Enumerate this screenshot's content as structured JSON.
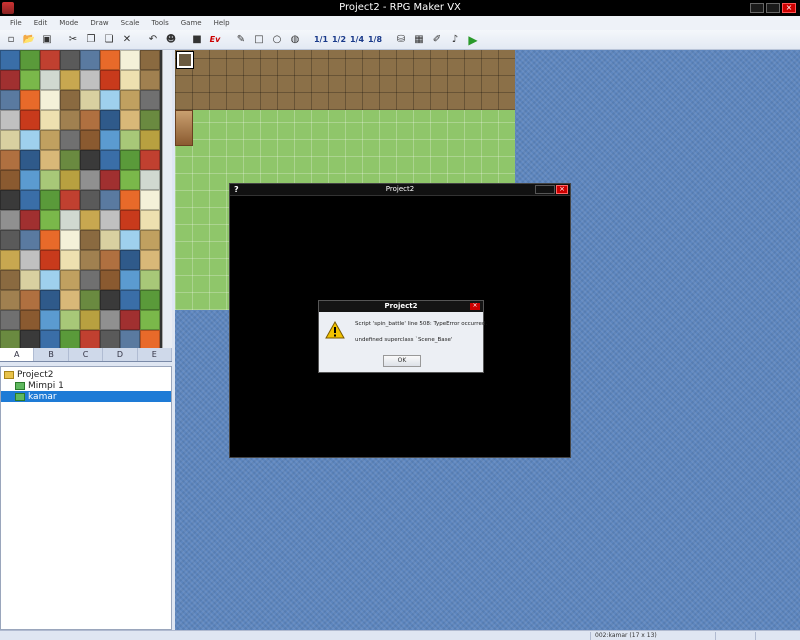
{
  "window": {
    "title": "Project2 - RPG Maker VX"
  },
  "menu": [
    "File",
    "Edit",
    "Mode",
    "Draw",
    "Scale",
    "Tools",
    "Game",
    "Help"
  ],
  "toolbar": {
    "icons": [
      "new-project-icon",
      "open-project-icon",
      "save-icon",
      "cut-icon",
      "copy-icon",
      "paste-icon",
      "delete-icon",
      "undo-icon",
      "character-icon",
      "event-layer-icon",
      "event-icon",
      "pencil-icon",
      "rectangle-icon",
      "ellipse-icon",
      "fill-icon",
      "select-icon"
    ],
    "scale_labels": [
      "1/1",
      "1/2",
      "1/4",
      "1/8"
    ],
    "tool_icons": [
      "database-icon",
      "materialbase-icon",
      "script-editor-icon",
      "sound-test-icon",
      "playtest-icon"
    ],
    "event_label": "Ev"
  },
  "tileset_tabs": [
    "A",
    "B",
    "C",
    "D",
    "E"
  ],
  "map_tree": {
    "project": "Project2",
    "maps": [
      {
        "name": "Mimpi 1",
        "selected": false
      },
      {
        "name": "kamar",
        "selected": true
      }
    ]
  },
  "game_window": {
    "title": "Project2"
  },
  "error_dialog": {
    "title": "Project2",
    "line1": "Script 'spin_battle' line 508: TypeError occurred.",
    "line2": "undefined superclass `Scene_Base'",
    "ok_label": "OK"
  },
  "status": {
    "map_info": "002:kamar (17 x 13)"
  },
  "colors": {
    "water": "#5d86bf",
    "grass_floor": "#8fc66a",
    "wall": "#8b7048",
    "selection": "#1e7bd6"
  }
}
